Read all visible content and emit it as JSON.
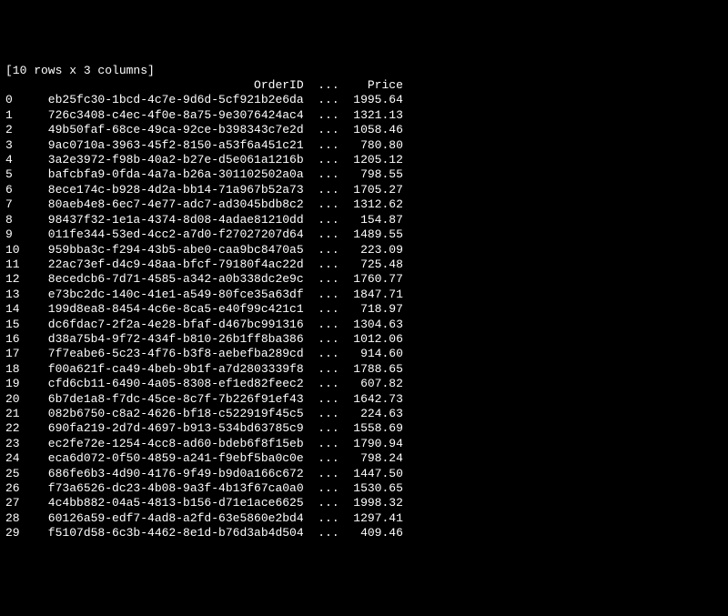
{
  "summary": "[10 rows x 3 columns]",
  "header": {
    "index_label": "",
    "col_orderid": "OrderID",
    "ellipsis": "...",
    "col_price": "Price"
  },
  "ellipsis": "...",
  "rows": [
    {
      "idx": "0",
      "orderid": "eb25fc30-1bcd-4c7e-9d6d-5cf921b2e6da",
      "price": "1995.64"
    },
    {
      "idx": "1",
      "orderid": "726c3408-c4ec-4f0e-8a75-9e3076424ac4",
      "price": "1321.13"
    },
    {
      "idx": "2",
      "orderid": "49b50faf-68ce-49ca-92ce-b398343c7e2d",
      "price": "1058.46"
    },
    {
      "idx": "3",
      "orderid": "9ac0710a-3963-45f2-8150-a53f6a451c21",
      "price": "780.80"
    },
    {
      "idx": "4",
      "orderid": "3a2e3972-f98b-40a2-b27e-d5e061a1216b",
      "price": "1205.12"
    },
    {
      "idx": "5",
      "orderid": "bafcbfa9-0fda-4a7a-b26a-301102502a0a",
      "price": "798.55"
    },
    {
      "idx": "6",
      "orderid": "8ece174c-b928-4d2a-bb14-71a967b52a73",
      "price": "1705.27"
    },
    {
      "idx": "7",
      "orderid": "80aeb4e8-6ec7-4e77-adc7-ad3045bdb8c2",
      "price": "1312.62"
    },
    {
      "idx": "8",
      "orderid": "98437f32-1e1a-4374-8d08-4adae81210dd",
      "price": "154.87"
    },
    {
      "idx": "9",
      "orderid": "011fe344-53ed-4cc2-a7d0-f27027207d64",
      "price": "1489.55"
    },
    {
      "idx": "10",
      "orderid": "959bba3c-f294-43b5-abe0-caa9bc8470a5",
      "price": "223.09"
    },
    {
      "idx": "11",
      "orderid": "22ac73ef-d4c9-48aa-bfcf-79180f4ac22d",
      "price": "725.48"
    },
    {
      "idx": "12",
      "orderid": "8ecedcb6-7d71-4585-a342-a0b338dc2e9c",
      "price": "1760.77"
    },
    {
      "idx": "13",
      "orderid": "e73bc2dc-140c-41e1-a549-80fce35a63df",
      "price": "1847.71"
    },
    {
      "idx": "14",
      "orderid": "199d8ea8-8454-4c6e-8ca5-e40f99c421c1",
      "price": "718.97"
    },
    {
      "idx": "15",
      "orderid": "dc6fdac7-2f2a-4e28-bfaf-d467bc991316",
      "price": "1304.63"
    },
    {
      "idx": "16",
      "orderid": "d38a75b4-9f72-434f-b810-26b1ff8ba386",
      "price": "1012.06"
    },
    {
      "idx": "17",
      "orderid": "7f7eabe6-5c23-4f76-b3f8-aebefba289cd",
      "price": "914.60"
    },
    {
      "idx": "18",
      "orderid": "f00a621f-ca49-4beb-9b1f-a7d2803339f8",
      "price": "1788.65"
    },
    {
      "idx": "19",
      "orderid": "cfd6cb11-6490-4a05-8308-ef1ed82feec2",
      "price": "607.82"
    },
    {
      "idx": "20",
      "orderid": "6b7de1a8-f7dc-45ce-8c7f-7b226f91ef43",
      "price": "1642.73"
    },
    {
      "idx": "21",
      "orderid": "082b6750-c8a2-4626-bf18-c522919f45c5",
      "price": "224.63"
    },
    {
      "idx": "22",
      "orderid": "690fa219-2d7d-4697-b913-534bd63785c9",
      "price": "1558.69"
    },
    {
      "idx": "23",
      "orderid": "ec2fe72e-1254-4cc8-ad60-bdeb6f8f15eb",
      "price": "1790.94"
    },
    {
      "idx": "24",
      "orderid": "eca6d072-0f50-4859-a241-f9ebf5ba0c0e",
      "price": "798.24"
    },
    {
      "idx": "25",
      "orderid": "686fe6b3-4d90-4176-9f49-b9d0a166c672",
      "price": "1447.50"
    },
    {
      "idx": "26",
      "orderid": "f73a6526-dc23-4b08-9a3f-4b13f67ca0a0",
      "price": "1530.65"
    },
    {
      "idx": "27",
      "orderid": "4c4bb882-04a5-4813-b156-d71e1ace6625",
      "price": "1998.32"
    },
    {
      "idx": "28",
      "orderid": "60126a59-edf7-4ad8-a2fd-63e5860e2bd4",
      "price": "1297.41"
    },
    {
      "idx": "29",
      "orderid": "f5107d58-6c3b-4462-8e1d-b76d3ab4d504",
      "price": "409.46"
    }
  ]
}
